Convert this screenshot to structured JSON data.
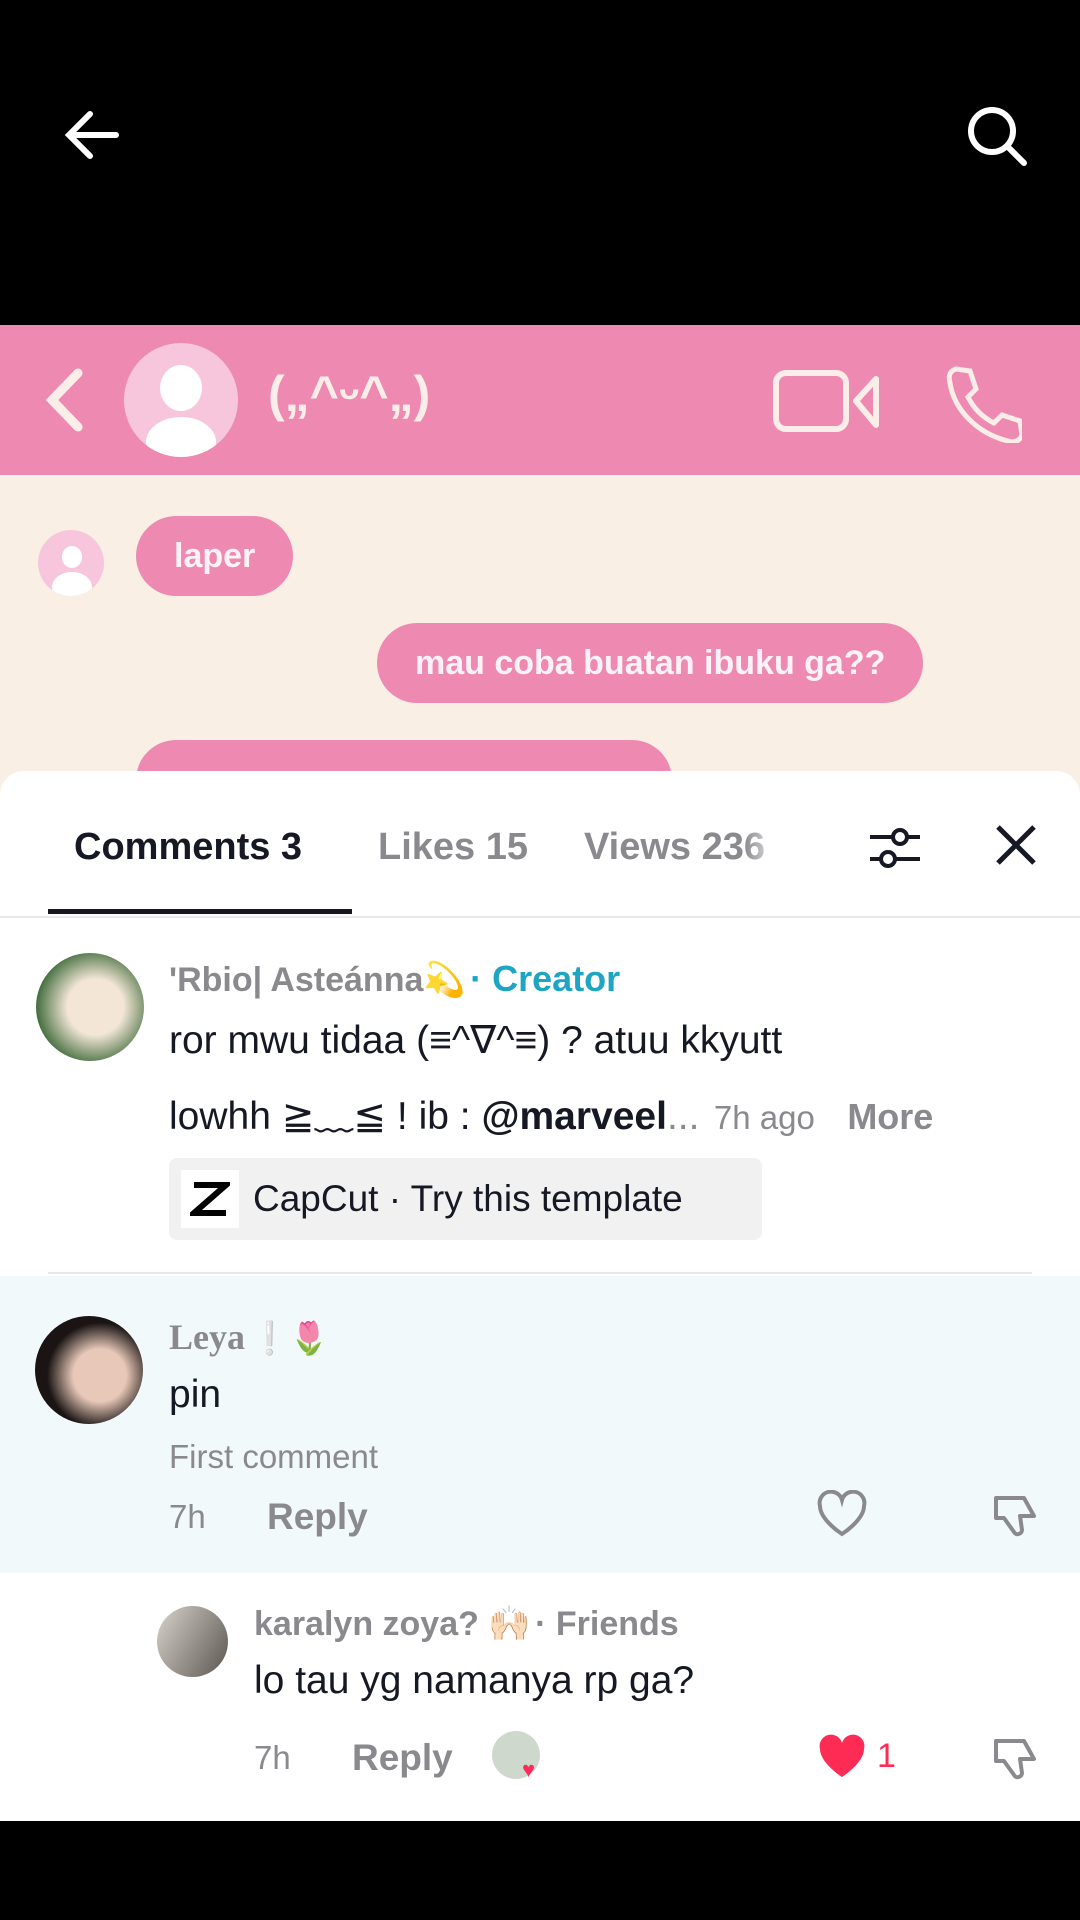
{
  "topbar": {
    "back_icon": "arrow-left-icon",
    "search_icon": "search-icon"
  },
  "video": {
    "contact_name": "(„^ᵕ^„)",
    "messages": [
      "laper",
      "mau coba buatan ibuku ga??"
    ]
  },
  "tabs": [
    {
      "label": "Comments 3"
    },
    {
      "label": "Likes 15"
    },
    {
      "label": "Views 236"
    }
  ],
  "comments": [
    {
      "author": "'Rbio| Asteánna💫",
      "badge": "· Creator",
      "text_line1": "ror mwu tidaa (≡^∇^≡) ? atuu kkyutt",
      "text_line2": "lowhh ≧﹏≦ !  ib : ",
      "mention": "@marveel",
      "ellipsis": "...",
      "time": "7h ago",
      "more": "More",
      "template": "CapCut · Try this template"
    },
    {
      "author": "Leya",
      "author_emoji": "❕🌷",
      "text": "pin",
      "label": "First comment",
      "time": "7h",
      "reply": "Reply"
    },
    {
      "author": "karalyn zoya? 🙌🏻",
      "badge": "· Friends",
      "text": "lo tau yg namanya rp ga?",
      "time": "7h",
      "reply": "Reply",
      "likes": "1"
    }
  ],
  "colors": {
    "accent_creator": "#1fa5c4",
    "like_red": "#fe2c55",
    "pinned_bg": "#f2f9fb",
    "chat_pink": "#ee8ab2"
  }
}
